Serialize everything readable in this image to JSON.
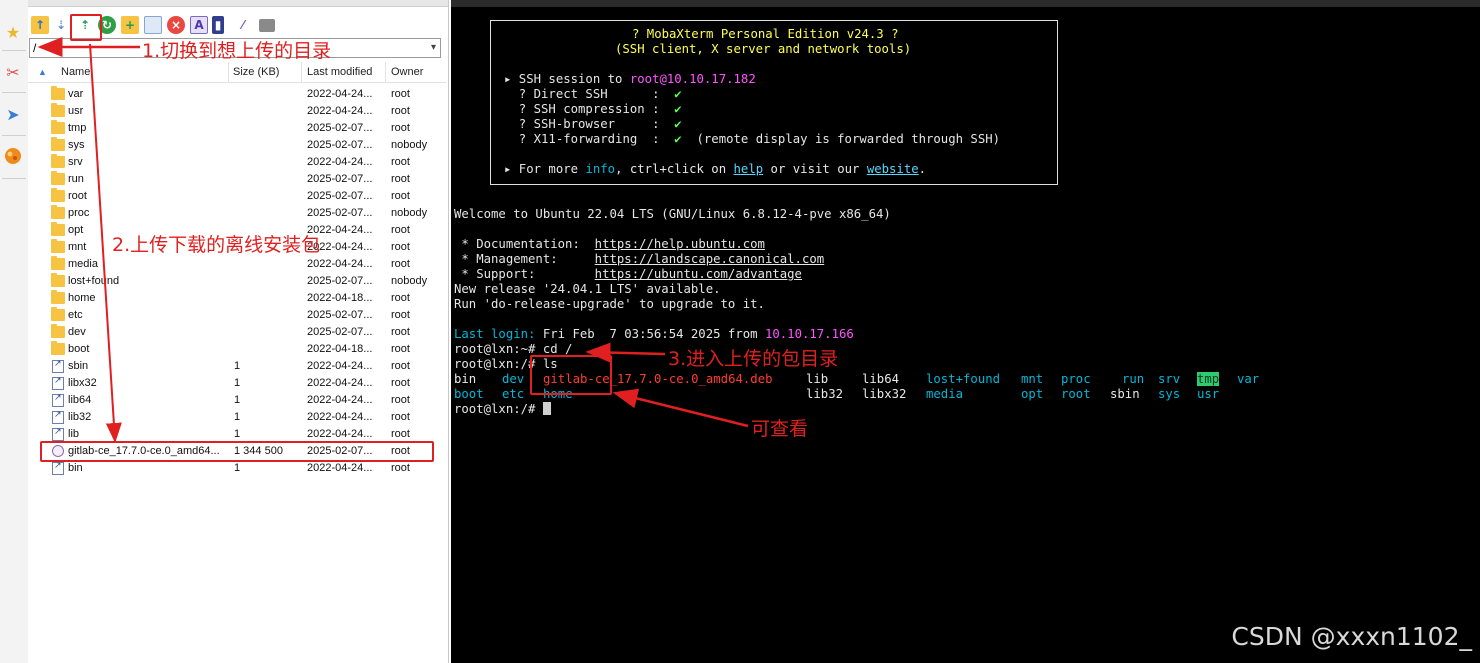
{
  "sidebar": {
    "icons": [
      "star-icon",
      "tools-icon",
      "send-icon",
      "globe-icon"
    ]
  },
  "sftp": {
    "toolbar_icons": [
      "parent-folder-icon",
      "download-icon",
      "upload-icon",
      "refresh-icon",
      "new-folder-icon",
      "new-file-icon",
      "delete-icon",
      "rename-icon",
      "permissions-icon",
      "settings-icon",
      "terminal-icon"
    ],
    "path": "/",
    "columns": {
      "name": "Name",
      "size": "Size (KB)",
      "modified": "Last modified",
      "owner": "Owner"
    },
    "files": [
      {
        "name": "var",
        "size": "",
        "modified": "2022-04-24...",
        "owner": "root",
        "type": "folder"
      },
      {
        "name": "usr",
        "size": "",
        "modified": "2022-04-24...",
        "owner": "root",
        "type": "folder"
      },
      {
        "name": "tmp",
        "size": "",
        "modified": "2025-02-07...",
        "owner": "root",
        "type": "folder"
      },
      {
        "name": "sys",
        "size": "",
        "modified": "2025-02-07...",
        "owner": "nobody",
        "type": "folder"
      },
      {
        "name": "srv",
        "size": "",
        "modified": "2022-04-24...",
        "owner": "root",
        "type": "folder"
      },
      {
        "name": "run",
        "size": "",
        "modified": "2025-02-07...",
        "owner": "root",
        "type": "folder"
      },
      {
        "name": "root",
        "size": "",
        "modified": "2025-02-07...",
        "owner": "root",
        "type": "folder"
      },
      {
        "name": "proc",
        "size": "",
        "modified": "2025-02-07...",
        "owner": "nobody",
        "type": "folder"
      },
      {
        "name": "opt",
        "size": "",
        "modified": "2022-04-24...",
        "owner": "root",
        "type": "folder"
      },
      {
        "name": "mnt",
        "size": "",
        "modified": "2022-04-24...",
        "owner": "root",
        "type": "folder"
      },
      {
        "name": "media",
        "size": "",
        "modified": "2022-04-24...",
        "owner": "root",
        "type": "folder"
      },
      {
        "name": "lost+found",
        "size": "",
        "modified": "2025-02-07...",
        "owner": "nobody",
        "type": "folder"
      },
      {
        "name": "home",
        "size": "",
        "modified": "2022-04-18...",
        "owner": "root",
        "type": "folder"
      },
      {
        "name": "etc",
        "size": "",
        "modified": "2025-02-07...",
        "owner": "root",
        "type": "folder"
      },
      {
        "name": "dev",
        "size": "",
        "modified": "2025-02-07...",
        "owner": "root",
        "type": "folder"
      },
      {
        "name": "boot",
        "size": "",
        "modified": "2022-04-18...",
        "owner": "root",
        "type": "folder"
      },
      {
        "name": "sbin",
        "size": "1",
        "modified": "2022-04-24...",
        "owner": "root",
        "type": "link"
      },
      {
        "name": "libx32",
        "size": "1",
        "modified": "2022-04-24...",
        "owner": "root",
        "type": "link"
      },
      {
        "name": "lib64",
        "size": "1",
        "modified": "2022-04-24...",
        "owner": "root",
        "type": "link"
      },
      {
        "name": "lib32",
        "size": "1",
        "modified": "2022-04-24...",
        "owner": "root",
        "type": "link"
      },
      {
        "name": "lib",
        "size": "1",
        "modified": "2022-04-24...",
        "owner": "root",
        "type": "link"
      },
      {
        "name": "gitlab-ce_17.7.0-ce.0_amd64...",
        "size": "1 344 500",
        "modified": "2025-02-07...",
        "owner": "root",
        "type": "deb"
      },
      {
        "name": "bin",
        "size": "1",
        "modified": "2022-04-24...",
        "owner": "root",
        "type": "link"
      }
    ]
  },
  "terminal": {
    "banner_title": "? MobaXterm Personal Edition v24.3 ?",
    "banner_subtitle": "(SSH client, X server and network tools)",
    "ssh_session_prefix": "▸ SSH session to ",
    "ssh_host": "root@10.10.17.182",
    "ssh_items": [
      {
        "label": "  ? Direct SSH      :  ",
        "value": "✔"
      },
      {
        "label": "  ? SSH compression :  ",
        "value": "✔"
      },
      {
        "label": "  ? SSH-browser     :  ",
        "value": "✔"
      },
      {
        "label": "  ? X11-forwarding  :  ",
        "value": "✔",
        "note": "  (remote display is forwarded through SSH)"
      }
    ],
    "more_info": {
      "p1": "▸ For more ",
      "info": "info",
      "p2": ", ctrl+click on ",
      "help": "help",
      "p3": " or visit our ",
      "website": "website",
      "p4": "."
    },
    "welcome": "Welcome to Ubuntu 22.04 LTS (GNU/Linux 6.8.12-4-pve x86_64)",
    "docs": [
      {
        "label": " * Documentation:  ",
        "url": "https://help.ubuntu.com"
      },
      {
        "label": " * Management:     ",
        "url": "https://landscape.canonical.com"
      },
      {
        "label": " * Support:        ",
        "url": "https://ubuntu.com/advantage"
      }
    ],
    "release_1": "New release '24.04.1 LTS' available.",
    "release_2": "Run 'do-release-upgrade' to upgrade to it.",
    "last_login_label": "Last login:",
    "last_login_value": " Fri Feb  7 03:56:54 2025 from ",
    "last_login_ip": "10.10.17.166",
    "cmd1": "root@lxn:~# cd /",
    "cmd2": "root@lxn:/# ls",
    "prompt": "root@lxn:/# ",
    "ls_row1": [
      "bin",
      "dev",
      "gitlab-ce_17.7.0-ce.0_amd64.deb",
      "lib",
      "lib64",
      "lost+found",
      "mnt",
      "proc",
      "run",
      "srv",
      "tmp",
      "var"
    ],
    "ls_row2": [
      "boot",
      "etc",
      "home",
      "lib32",
      "libx32",
      "media",
      "opt",
      "root",
      "sbin",
      "sys",
      "usr"
    ]
  },
  "annotations": {
    "step1": "1.切换到想上传的目录",
    "step2": "2.上传下载的离线安装包",
    "step3": "3.进入上传的包目录",
    "view": "可查看"
  },
  "watermark": "CSDN @xxxn1102_",
  "colors": {
    "annotation": "#e02020",
    "terminal_bg": "#000000",
    "folder": "#f6c343"
  }
}
